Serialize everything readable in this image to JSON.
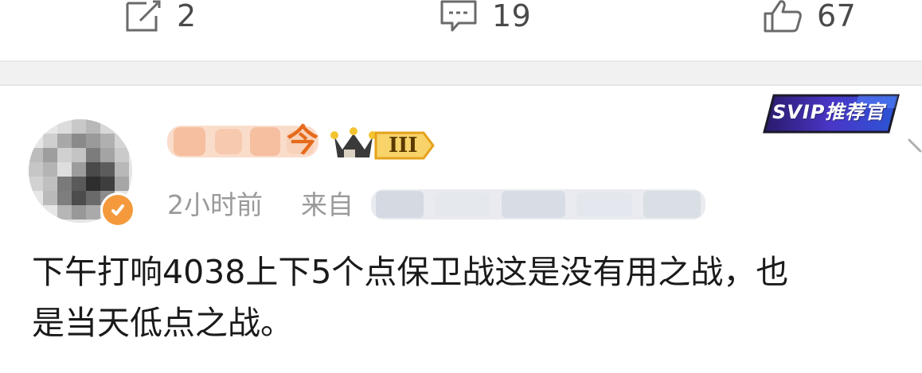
{
  "actions": {
    "repost": {
      "icon": "edit-square-icon",
      "count": "2"
    },
    "comment": {
      "icon": "comment-bubble-icon",
      "count": "19"
    },
    "like": {
      "icon": "thumbs-up-icon",
      "count": "67"
    }
  },
  "post": {
    "author": {
      "avatar": "pixelated-avatar",
      "name_visible_glyph": "今",
      "level_badge": "III",
      "verified_icon": "verified-badge-icon"
    },
    "svip_badge": "SVIP推荐官",
    "time": "2小时前",
    "from_label": "来自",
    "text": "下午打响4038上下5个点保卫战这是没有用之战，也\n是当天低点之战。"
  },
  "colors": {
    "accent_orange": "#e66a1b",
    "muted_text": "#9a9a9a",
    "gap_background": "#f1f1f1"
  }
}
